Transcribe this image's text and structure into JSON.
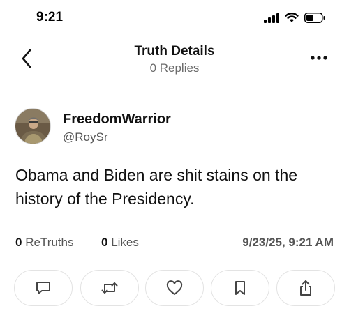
{
  "status_bar": {
    "time": "9:21",
    "icons": [
      "signal-icon",
      "wifi-icon",
      "battery-icon"
    ]
  },
  "header": {
    "title": "Truth Details",
    "subtitle": "0 Replies",
    "back_icon": "chevron-left-icon",
    "more_icon": "more-horizontal-icon"
  },
  "post": {
    "author": {
      "display_name": "FreedomWarrior",
      "username": "@RoySr"
    },
    "text": "Obama and Biden are shit stains on the history of the Presidency.",
    "stats": {
      "retruths_count": "0",
      "retruths_label": "ReTruths",
      "likes_count": "0",
      "likes_label": "Likes",
      "timestamp": "9/23/25, 9:21 AM"
    },
    "actions": [
      "reply-icon",
      "retruth-icon",
      "like-icon",
      "bookmark-icon",
      "share-icon"
    ]
  },
  "colors": {
    "text": "#111111",
    "secondary_text": "#555555",
    "border": "#e3e3e3",
    "background": "#ffffff"
  }
}
